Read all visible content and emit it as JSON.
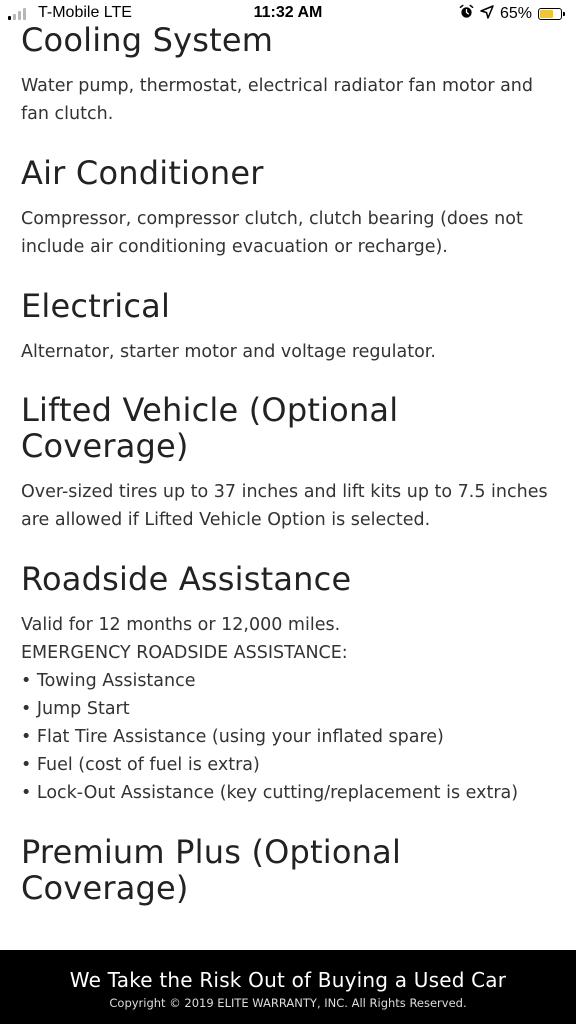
{
  "status_bar": {
    "carrier": "T-Mobile LTE",
    "time": "11:32 AM",
    "battery_percent": "65%",
    "battery_level": 0.65,
    "icons": [
      "signal-icon",
      "alarm-icon",
      "location-arrow-icon",
      "battery-icon"
    ]
  },
  "sections": [
    {
      "title": "Cooling System",
      "lines": [
        "Water pump, thermostat, electrical radiator fan motor and fan clutch."
      ]
    },
    {
      "title": "Air Conditioner",
      "lines": [
        "Compressor, compressor clutch, clutch bearing (does not include air conditioning evacuation or recharge)."
      ]
    },
    {
      "title": "Electrical",
      "lines": [
        "Alternator, starter motor and voltage regulator."
      ]
    },
    {
      "title": "Lifted Vehicle (Optional Coverage)",
      "lines": [
        "Over-sized tires up to 37 inches and lift kits up to 7.5 inches are allowed if Lifted Vehicle Option is selected."
      ]
    },
    {
      "title": "Roadside Assistance",
      "lines": [
        "Valid for 12 months or 12,000 miles.",
        "EMERGENCY ROADSIDE ASSISTANCE:",
        "• Towing Assistance",
        "• Jump Start",
        "• Flat Tire Assistance (using your inflated spare)",
        "• Fuel (cost of fuel is extra)",
        "• Lock-Out Assistance (key cutting/replacement is extra)"
      ]
    },
    {
      "title": "Premium Plus (Optional Coverage)",
      "lines": []
    }
  ],
  "footer": {
    "tagline": "We Take the Risk Out of Buying a Used Car",
    "copyright": "Copyright © 2019 ELITE WARRANTY, INC. All Rights Reserved."
  },
  "colors": {
    "footer_bg": "#000000",
    "battery_fill": "#f2c335",
    "text": "#222222"
  }
}
